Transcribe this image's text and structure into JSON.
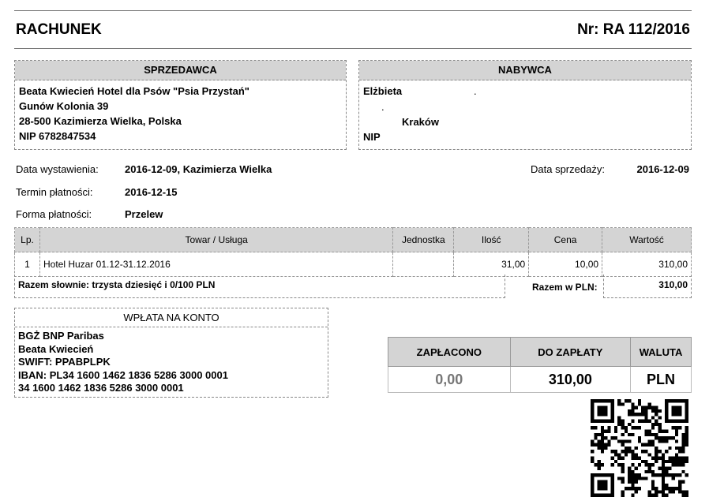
{
  "header": {
    "title": "RACHUNEK",
    "number": "Nr: RA 112/2016"
  },
  "seller": {
    "heading": "SPRZEDAWCA",
    "name": "Beata Kwiecień Hotel dla Psów \"Psia Przystań\"",
    "street": "Gunów Kolonia 39",
    "city": "28-500 Kazimierza Wielka, Polska",
    "nip": "NIP 6782847534"
  },
  "buyer": {
    "heading": "NABYWCA",
    "name": "Elżbieta",
    "dot1": ".",
    "dot2": ".",
    "city": "Kraków",
    "nip": "NIP"
  },
  "meta": {
    "issue_label": "Data wystawienia:",
    "issue_value": "2016-12-09, Kazimierza Wielka",
    "sale_label": "Data sprzedaży:",
    "sale_value": "2016-12-09",
    "due_label": "Termin płatności:",
    "due_value": "2016-12-15",
    "method_label": "Forma płatności:",
    "method_value": "Przelew"
  },
  "items": {
    "headers": [
      "Lp.",
      "Towar / Usługa",
      "Jednostka",
      "Ilość",
      "Cena",
      "Wartość"
    ],
    "rows": [
      [
        "1",
        "Hotel Huzar 01.12-31.12.2016",
        "",
        "31,00",
        "10,00",
        "310,00"
      ]
    ],
    "words": "Razem słownie: trzysta dziesięć i 0/100 PLN",
    "total_label": "Razem w PLN:",
    "total_value": "310,00"
  },
  "bank": {
    "heading": "WPŁATA NA KONTO",
    "lines": [
      "BGŻ BNP Paribas",
      "Beata Kwiecień",
      "SWIFT: PPABPLPK",
      "IBAN: PL34 1600 1462 1836 5286 3000 0001",
      "34 1600 1462 1836 5286 3000 0001"
    ]
  },
  "summary": {
    "paid_label": "ZAPŁACONO",
    "due_label": "DO ZAPŁATY",
    "currency_label": "WALUTA",
    "paid_value": "0,00",
    "due_value": "310,00",
    "currency_value": "PLN",
    "paid_color": "#777777"
  }
}
